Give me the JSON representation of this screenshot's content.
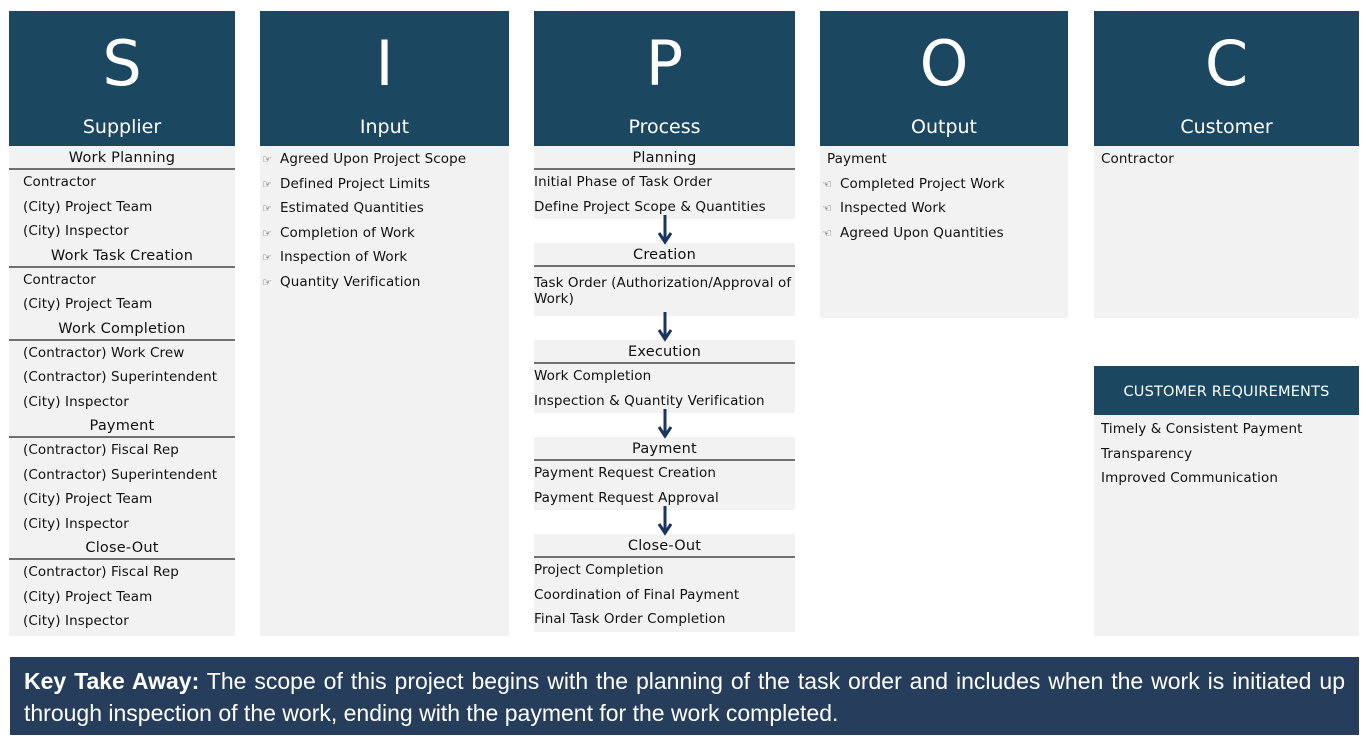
{
  "colors": {
    "header_bg": "#1b4760",
    "body_bg": "#f2f2f2",
    "banner_bg": "#263e5c",
    "arrow": "#1b3460"
  },
  "supplier": {
    "letter": "S",
    "title": "Supplier",
    "groups": [
      {
        "heading": "Work Planning",
        "items": [
          "Contractor",
          "(City) Project Team",
          "(City) Inspector"
        ]
      },
      {
        "heading": "Work Task Creation",
        "items": [
          "Contractor",
          "(City) Project Team"
        ]
      },
      {
        "heading": "Work Completion",
        "items": [
          "(Contractor) Work Crew",
          "(Contractor) Superintendent",
          "(City) Inspector"
        ]
      },
      {
        "heading": "Payment",
        "items": [
          "(Contractor) Fiscal Rep",
          "(Contractor) Superintendent",
          "(City) Project Team",
          "(City) Inspector"
        ]
      },
      {
        "heading": "Close-Out",
        "items": [
          "(Contractor) Fiscal Rep",
          "(City) Project Team",
          "(City) Inspector"
        ]
      }
    ]
  },
  "input": {
    "letter": "I",
    "title": "Input",
    "bullet_icon": "pointing-hand-icon",
    "items": [
      "Agreed Upon Project Scope",
      "Defined Project Limits",
      "Estimated Quantities",
      "Completion of Work",
      "Inspection of Work",
      "Quantity Verification"
    ]
  },
  "process": {
    "letter": "P",
    "title": "Process",
    "steps": [
      {
        "heading": "Planning",
        "items": [
          "Initial Phase of Task Order",
          "Define Project Scope & Quantities"
        ]
      },
      {
        "heading": "Creation",
        "items": [
          "Task Order (Authorization/Approval of Work)"
        ]
      },
      {
        "heading": "Execution",
        "items": [
          "Work Completion",
          "Inspection & Quantity Verification"
        ]
      },
      {
        "heading": "Payment",
        "items": [
          "Payment Request Creation",
          "Payment Request Approval"
        ]
      },
      {
        "heading": "Close-Out",
        "items": [
          "Project Completion",
          "Coordination of Final Payment",
          "Final Task Order Completion"
        ]
      }
    ]
  },
  "output": {
    "letter": "O",
    "title": "Output",
    "lead": "Payment",
    "bullet_icon": "pointing-hand-icon",
    "items": [
      "Completed Project Work",
      "Inspected Work",
      "Agreed Upon Quantities"
    ]
  },
  "customer": {
    "letter": "C",
    "title": "Customer",
    "items": [
      "Contractor"
    ],
    "requirements_title": "CUSTOMER REQUIREMENTS",
    "requirements": [
      "Timely & Consistent Payment",
      "Transparency",
      "Improved Communication"
    ]
  },
  "banner": {
    "label": "Key Take Away:",
    "text": " The scope of this project begins with the planning of the task order and includes when the work is initiated up through inspection of the work, ending with the payment for the work completed."
  }
}
